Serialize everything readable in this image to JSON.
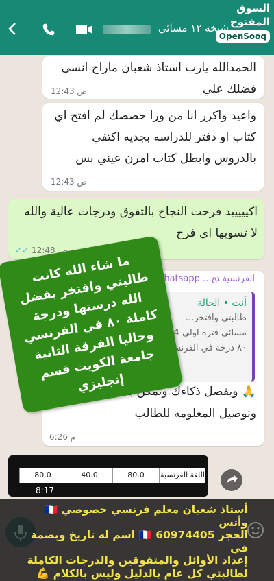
{
  "header": {
    "title": "شيخه ١٢ مسائي",
    "brand_ar": "السوق المفتوح",
    "brand_en": "OpenSooq",
    "header_color": "#178a76"
  },
  "messages": [
    {
      "text": "الحمدالله يارب استاذ شعبان ماراح انسى فضلك علي",
      "time": "12:43 ص"
    },
    {
      "text": "واعيد واكرر انا من ورا حصصك لم افتح اي كتاب او دفتر للدراسه بجديه اكتفي بالدروس وابطل كتاب امرن عيني بس",
      "time": "12:43 ص"
    },
    {
      "text": "اكيييييد فرحت النجاح بالتفوق ودرجات عالية والله لا تسويها اي فرح",
      "time": "12:48 ص",
      "ticks": "✓✓"
    }
  ],
  "forwarded": {
    "header": "الفرنسية تخ... cais 🇫🇷 whatsapp",
    "quote_author": "أنت • الحالة",
    "quote_lines": [
      "طالبتي وافتخر...",
      "مسائي فترة اولي 34",
      "٨٠ درجة في الفرنسي بف..."
    ],
    "text": "🙏 وبفضل ذكاءك وتمكن بطرق التدريس وتوصيل المعلومه للطالب",
    "time": "6:26 م"
  },
  "sticker_text": "ما شاء الله كانت طالبتي وافتخر بفضل الله درستها ودرجة كاملة ٨٠ في الفرنسي وحاليا الفرقة الثانية جامعة الكويت قسم إنجليزي",
  "media": {
    "cells": [
      "80.0",
      "40.0",
      "80.0",
      "اللغة الفرنسية"
    ],
    "time": "8:17"
  },
  "ad": {
    "lines": [
      "أستاذ شعبان معلم فرنسي خصوصي 🇫🇷 وأتس",
      "الحجز 60974405 🇫🇷 اسم له تاريخ وبصمة في",
      "إعداد الأوائل والمتفوقين والدرجات الكاملة",
      "لطالبتي كل عام بالدليل وليس بالكلام 💪 بفضل الله"
    ]
  }
}
